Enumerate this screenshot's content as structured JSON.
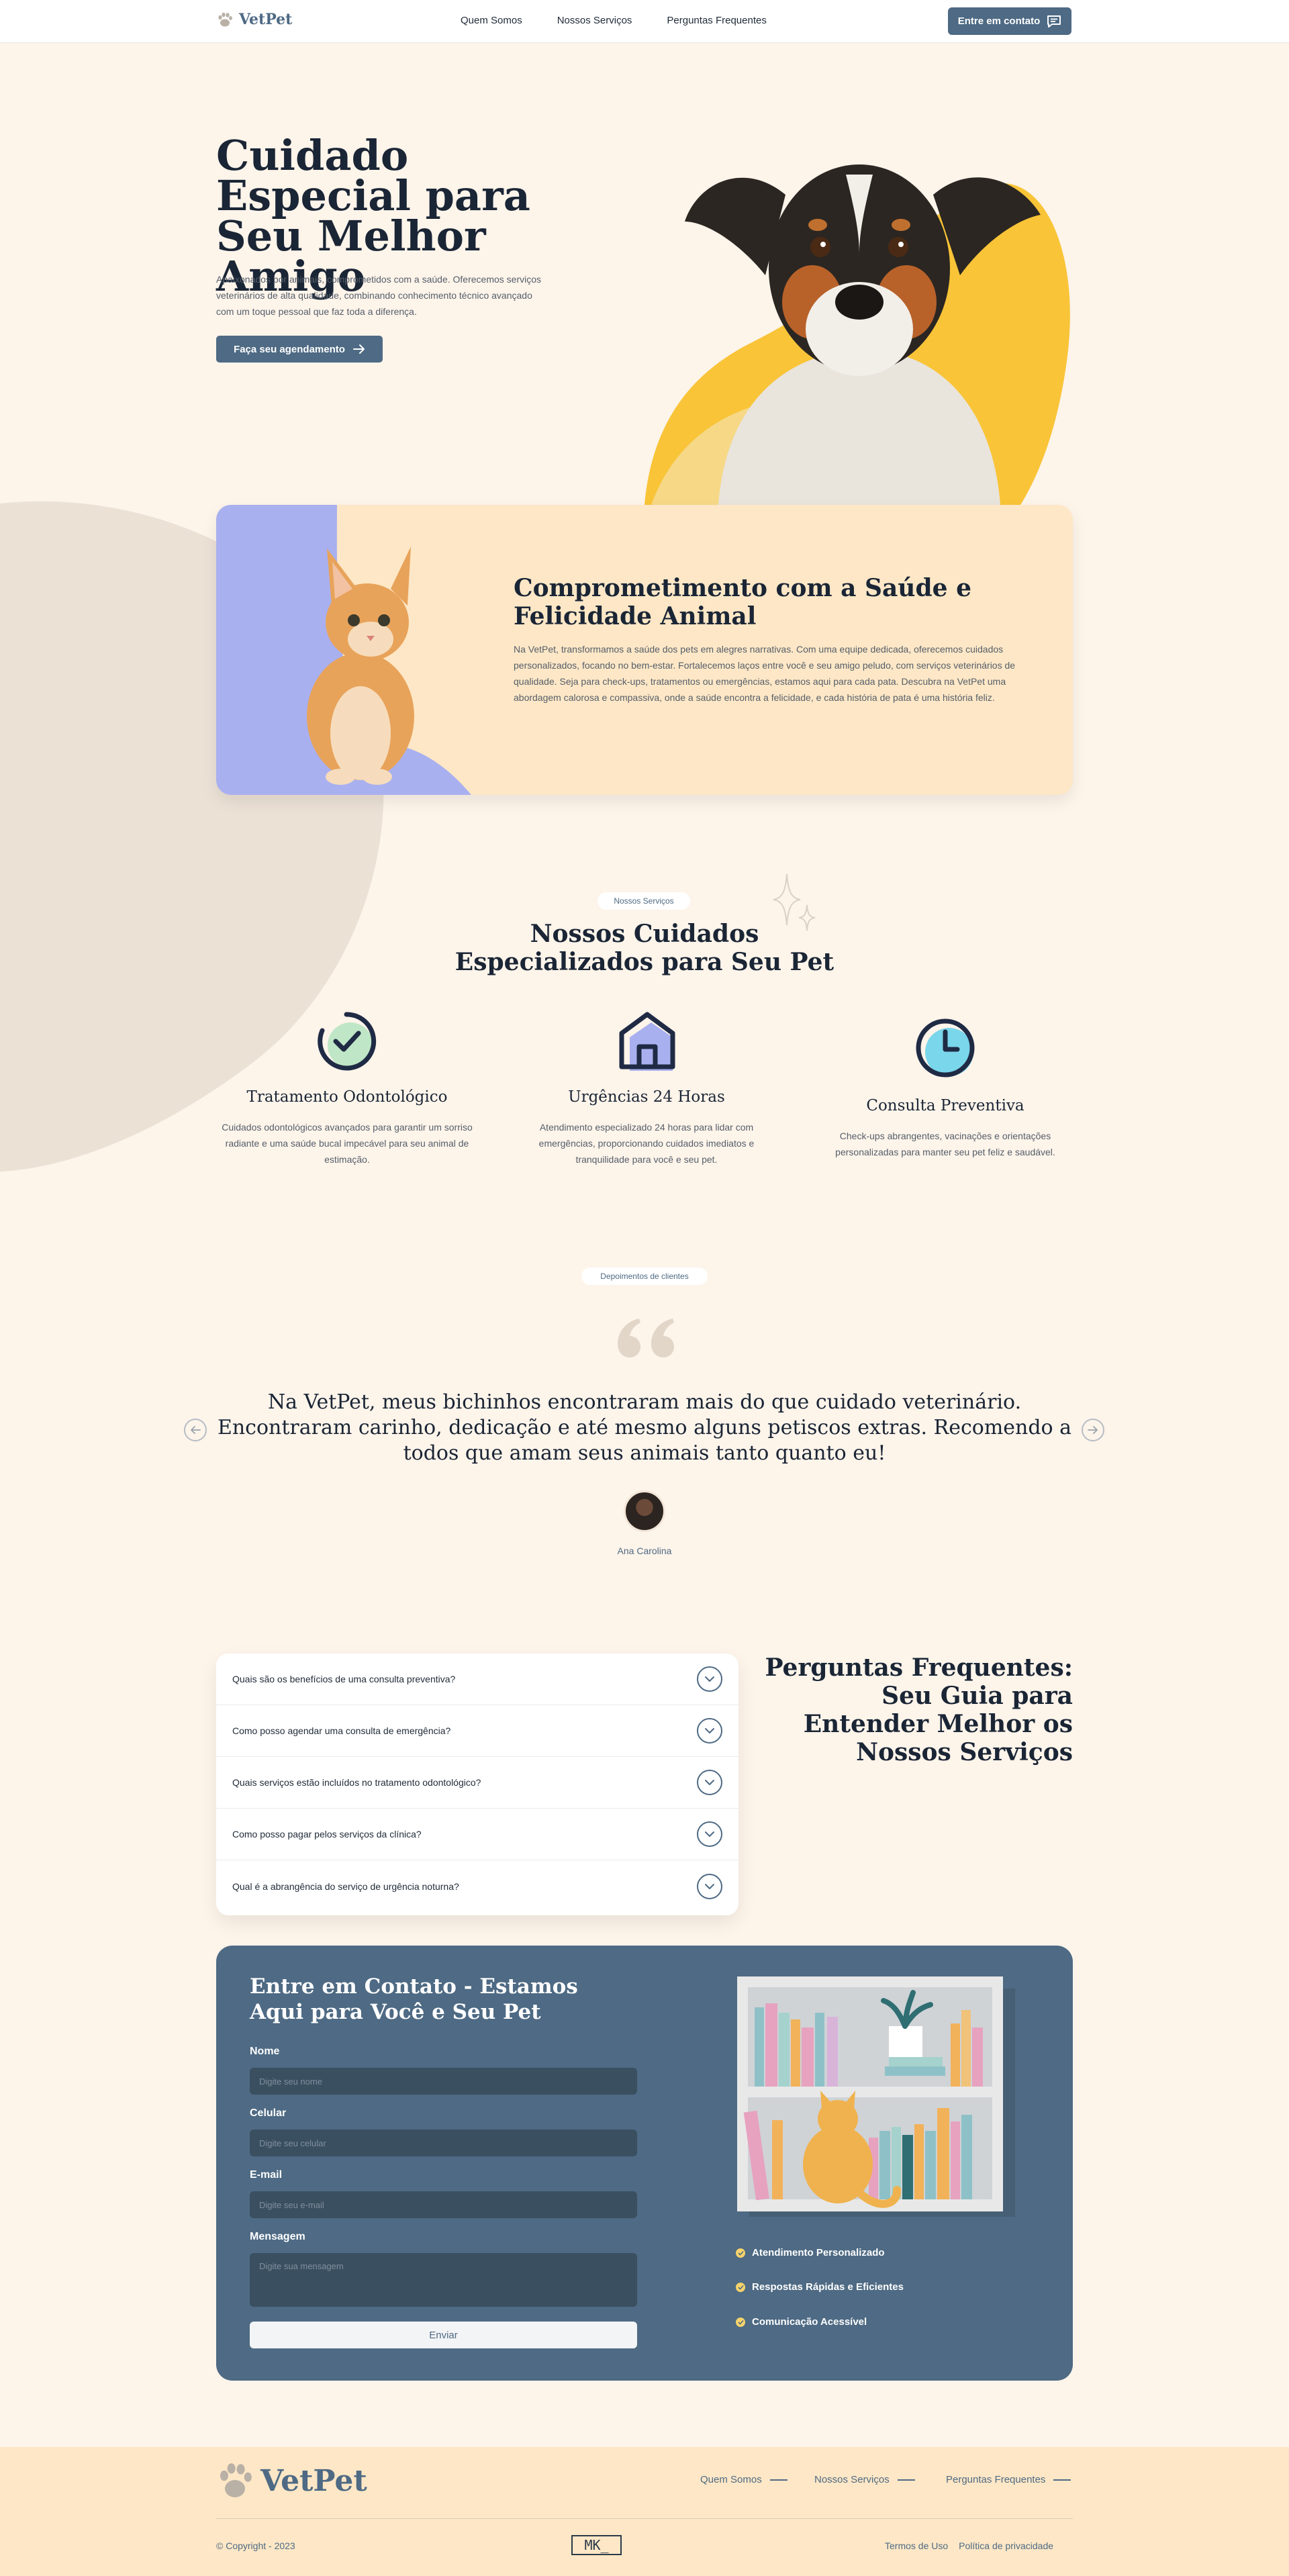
{
  "header": {
    "brand": "VetPet",
    "nav": [
      "Quem Somos",
      "Nossos Serviços",
      "Perguntas Frequentes"
    ],
    "contact_button": "Entre em contato"
  },
  "hero": {
    "title": "Cuidado Especial para Seu Melhor Amigo",
    "text": "Apaixonados por animais, comprometidos com a saúde. Oferecemos serviços veterinários de alta qualidade, combinando conhecimento técnico avançado com um toque pessoal que faz toda a diferença.",
    "button": "Faça seu agendamento"
  },
  "commitment": {
    "title": "Comprometimento com a Saúde e Felicidade Animal",
    "text": "Na VetPet, transformamos a saúde dos pets em alegres narrativas. Com uma equipe dedicada, oferecemos cuidados personalizados, focando no bem-estar. Fortalecemos laços entre você e seu amigo peludo, com serviços veterinários de qualidade. Seja para check-ups, tratamentos ou emergências, estamos aqui para cada pata. Descubra na VetPet uma abordagem calorosa e compassiva, onde a saúde encontra a felicidade, e cada história de pata é uma história feliz."
  },
  "services": {
    "pill": "Nossos Serviços",
    "title": "Nossos Cuidados Especializados para Seu Pet",
    "items": [
      {
        "title": "Tratamento Odontológico",
        "text": "Cuidados odontológicos avançados para garantir um sorriso radiante e uma saúde bucal impecável para seu animal de estimação.",
        "icon": "check-circle-icon"
      },
      {
        "title": "Urgências 24 Horas",
        "text": "Atendimento especializado 24 horas para lidar com emergências, proporcionando cuidados imediatos e tranquilidade para você e seu pet.",
        "icon": "house-icon"
      },
      {
        "title": "Consulta Preventiva",
        "text": "Check-ups abrangentes, vacinações e orientações personalizadas para manter seu pet feliz e saudável.",
        "icon": "clock-icon"
      }
    ]
  },
  "testimonials": {
    "pill": "Depoimentos de clientes",
    "quote": "Na VetPet, meus bichinhos encontraram mais do que cuidado veterinário. Encontraram carinho, dedicação e até mesmo alguns petiscos extras. Recomendo a todos que amam seus animais tanto quanto eu!",
    "author": "Ana Carolina"
  },
  "faq": {
    "title": "Perguntas Frequentes: Seu Guia para Entender Melhor os Nossos Serviços",
    "items": [
      "Quais são os benefícios de uma consulta preventiva?",
      "Como posso agendar uma consulta de emergência?",
      "Quais serviços estão incluídos no tratamento odontológico?",
      "Como posso pagar pelos serviços da clínica?",
      "Qual é a abrangência do serviço de urgência noturna?"
    ]
  },
  "contact": {
    "title": "Entre em Contato - Estamos Aqui para Você e Seu Pet",
    "fields": {
      "name_label": "Nome",
      "name_placeholder": "Digite seu nome",
      "phone_label": "Celular",
      "phone_placeholder": "Digite seu celular",
      "email_label": "E-mail",
      "email_placeholder": "Digite seu e-mail",
      "message_label": "Mensagem",
      "message_placeholder": "Digite sua mensagem"
    },
    "send_button": "Enviar",
    "features": [
      "Atendimento Personalizado",
      "Respostas Rápidas e Eficientes",
      "Comunicação Acessível"
    ]
  },
  "footer": {
    "brand": "VetPet",
    "nav": [
      "Quem Somos",
      "Nossos Serviços",
      "Perguntas Frequentes"
    ],
    "copyright": "© Copyright - 2023",
    "maker_mark": "MK_",
    "legal": [
      "Termos de Uso",
      "Política de privacidade"
    ]
  },
  "colors": {
    "primary": "#4e6a84",
    "background": "#fdf4ea",
    "peach": "#fde7c6",
    "yellow": "#f7c948",
    "lavender": "#aab0f0"
  }
}
